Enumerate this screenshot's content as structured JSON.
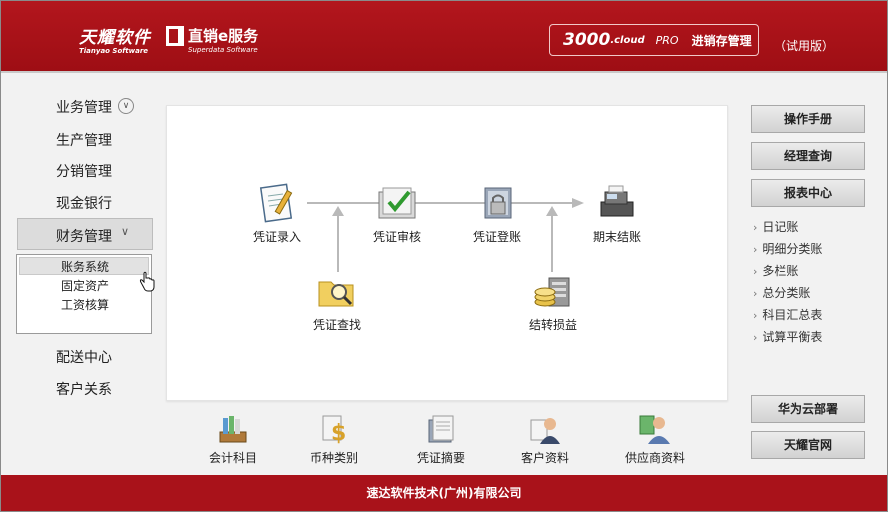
{
  "header": {
    "logo_brand": "天耀软件",
    "logo_brand_sub": "Tianyao Software",
    "logo_service": "直销e服务",
    "logo_service_sub": "Superdata Software",
    "product_number": "3000",
    "product_cloud": ".cloud",
    "product_edition": "PRO",
    "product_name": "进销存管理",
    "trial_label": "（试用版）"
  },
  "nav": {
    "items": [
      "业务管理",
      "生产管理",
      "分销管理",
      "现金银行",
      "财务管理",
      "配送中心",
      "客户关系"
    ],
    "expand_icon": "chevron-down-circle",
    "finance_submenu": [
      "账务系统",
      "固定资产",
      "工资核算"
    ],
    "selected": "账务系统"
  },
  "flow": {
    "nodes": {
      "voucher_entry": "凭证录入",
      "voucher_audit": "凭证审核",
      "voucher_post": "凭证登账",
      "period_close": "期末结账",
      "voucher_search": "凭证查找",
      "transfer_pl": "结转损益"
    }
  },
  "toolbar": {
    "items": [
      "会计科目",
      "币种类别",
      "凭证摘要",
      "客户资料",
      "供应商资料"
    ]
  },
  "right": {
    "manual": "操作手册",
    "manager_query": "经理查询",
    "report_center": "报表中心",
    "reports": [
      "日记账",
      "明细分类账",
      "多栏账",
      "总分类账",
      "科目汇总表",
      "试算平衡表"
    ],
    "huawei": "华为云部署",
    "official_site": "天耀官网"
  },
  "footer": {
    "company": "速达软件技术(广州)有限公司"
  },
  "colors": {
    "brand_red": "#b3161d",
    "footer_red": "#a9121a",
    "panel_bg": "#ffffff"
  }
}
